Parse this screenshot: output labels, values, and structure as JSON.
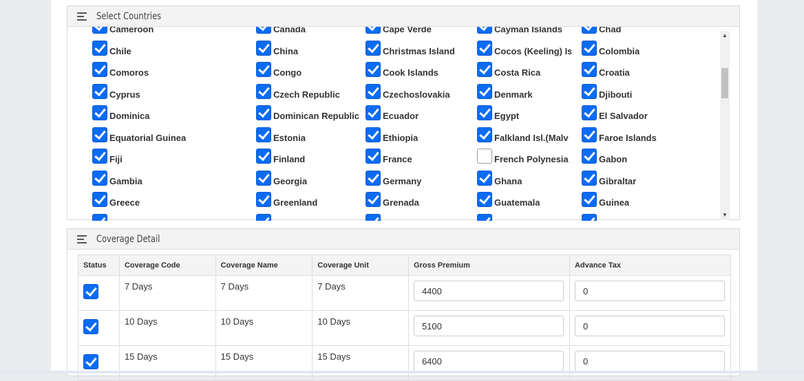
{
  "countries_panel": {
    "title": "Select Countries",
    "rows": [
      [
        {
          "name": "Cameroon",
          "checked": true
        },
        {
          "name": "Canada",
          "checked": true
        },
        {
          "name": "Cape Verde",
          "checked": true
        },
        {
          "name": "Cayman Islands",
          "checked": true
        },
        {
          "name": "Chad",
          "checked": true
        }
      ],
      [
        {
          "name": "Chile",
          "checked": true
        },
        {
          "name": "China",
          "checked": true
        },
        {
          "name": "Christmas Island",
          "checked": true
        },
        {
          "name": "Cocos (Keeling) Is",
          "checked": true
        },
        {
          "name": "Colombia",
          "checked": true
        }
      ],
      [
        {
          "name": "Comoros",
          "checked": true
        },
        {
          "name": "Congo",
          "checked": true
        },
        {
          "name": "Cook Islands",
          "checked": true
        },
        {
          "name": "Costa Rica",
          "checked": true
        },
        {
          "name": "Croatia",
          "checked": true
        }
      ],
      [
        {
          "name": "Cyprus",
          "checked": true
        },
        {
          "name": "Czech Republic",
          "checked": true
        },
        {
          "name": "Czechoslovakia",
          "checked": true
        },
        {
          "name": "Denmark",
          "checked": true
        },
        {
          "name": "Djibouti",
          "checked": true
        }
      ],
      [
        {
          "name": "Dominica",
          "checked": true
        },
        {
          "name": "Dominican Republic",
          "checked": true
        },
        {
          "name": "Ecuador",
          "checked": true
        },
        {
          "name": "Egypt",
          "checked": true
        },
        {
          "name": "El Salvador",
          "checked": true
        }
      ],
      [
        {
          "name": "Equatorial Guinea",
          "checked": true
        },
        {
          "name": "Estonia",
          "checked": true
        },
        {
          "name": "Ethiopia",
          "checked": true
        },
        {
          "name": "Falkland Isl.(Malv",
          "checked": true
        },
        {
          "name": "Faroe Islands",
          "checked": true
        }
      ],
      [
        {
          "name": "Fiji",
          "checked": true
        },
        {
          "name": "Finland",
          "checked": true
        },
        {
          "name": "France",
          "checked": true
        },
        {
          "name": "French Polynesia",
          "checked": false
        },
        {
          "name": "Gabon",
          "checked": true
        }
      ],
      [
        {
          "name": "Gambia",
          "checked": true
        },
        {
          "name": "Georgia",
          "checked": true
        },
        {
          "name": "Germany",
          "checked": true
        },
        {
          "name": "Ghana",
          "checked": true
        },
        {
          "name": "Gibraltar",
          "checked": true
        }
      ],
      [
        {
          "name": "Greece",
          "checked": true
        },
        {
          "name": "Greenland",
          "checked": true
        },
        {
          "name": "Grenada",
          "checked": true
        },
        {
          "name": "Guatemala",
          "checked": true
        },
        {
          "name": "Guinea",
          "checked": true
        }
      ],
      [
        {
          "name": "",
          "checked": true
        },
        {
          "name": "",
          "checked": true
        },
        {
          "name": "",
          "checked": true
        },
        {
          "name": "",
          "checked": true
        },
        {
          "name": "",
          "checked": true
        }
      ]
    ]
  },
  "coverage_panel": {
    "title": "Coverage Detail",
    "columns": [
      "Status",
      "Coverage Code",
      "Coverage Name",
      "Coverage Unit",
      "Gross Premium",
      "Advance Tax"
    ],
    "rows": [
      {
        "checked": true,
        "code": "7 Days",
        "name": "7 Days",
        "unit": "7 Days",
        "gross_premium": "4400",
        "advance_tax": "0"
      },
      {
        "checked": true,
        "code": "10 Days",
        "name": "10 Days",
        "unit": "10 Days",
        "gross_premium": "5100",
        "advance_tax": "0"
      },
      {
        "checked": true,
        "code": "15 Days",
        "name": "15 Days",
        "unit": "15 Days",
        "gross_premium": "6400",
        "advance_tax": "0"
      }
    ]
  },
  "colors": {
    "checkbox_accent": "#0a6cf4",
    "panel_header_bg": "#f3f3f3",
    "page_bg": "#e9ebee"
  },
  "icons": {
    "panel_header": "list-icon",
    "checkbox": "checkmark-icon",
    "scroll_up": "triangle-up-icon",
    "scroll_down": "triangle-down-icon"
  }
}
